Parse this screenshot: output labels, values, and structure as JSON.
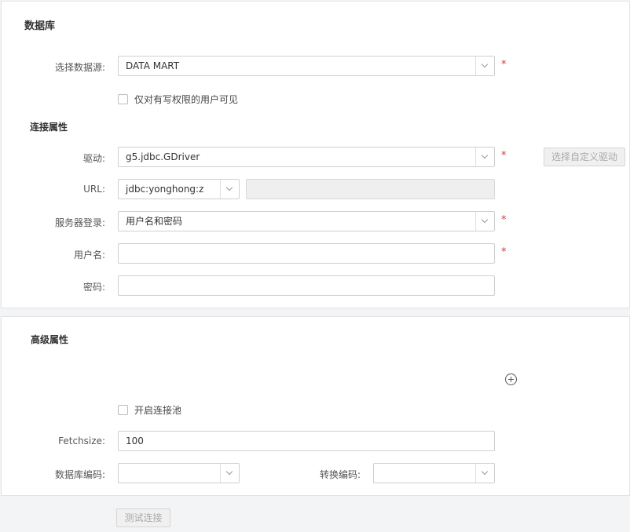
{
  "database": {
    "title": "数据库",
    "datasource": {
      "label": "选择数据源:",
      "value": "DATA MART"
    },
    "write_only_checkbox": {
      "label": "仅对有写权限的用户可见",
      "checked": false
    },
    "connection_section_title": "连接属性",
    "driver": {
      "label": "驱动:",
      "value": "g5.jdbc.GDriver"
    },
    "custom_driver_button": "选择自定义驱动",
    "url": {
      "label": "URL:",
      "prefix": "jdbc:yonghong:z",
      "value": ""
    },
    "login": {
      "label": "服务器登录:",
      "value": "用户名和密码"
    },
    "username": {
      "label": "用户名:",
      "value": ""
    },
    "password": {
      "label": "密码:",
      "value": ""
    },
    "required_mark": "*"
  },
  "advanced": {
    "title": "高级属性",
    "add_icon": "circle-plus-icon",
    "pool_checkbox": {
      "label": "开启连接池",
      "checked": false
    },
    "fetchsize": {
      "label": "Fetchsize:",
      "value": "100"
    },
    "db_encoding": {
      "label": "数据库编码:",
      "value": ""
    },
    "convert_encoding": {
      "label": "转换编码:",
      "value": ""
    }
  },
  "footer": {
    "test_button": "测试连接"
  }
}
